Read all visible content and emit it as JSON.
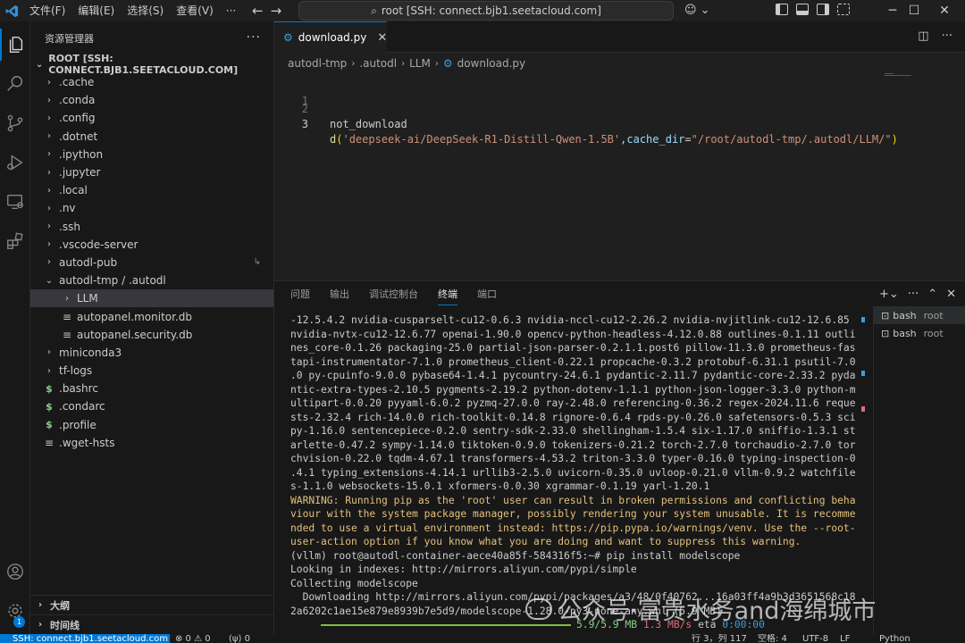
{
  "titlebar": {
    "menus": [
      "文件(F)",
      "编辑(E)",
      "选择(S)",
      "查看(V)"
    ],
    "more": "···",
    "search": "root [SSH: connect.bjb1.seetacloud.com]"
  },
  "sidebar": {
    "title": "资源管理器",
    "root": "ROOT [SSH: CONNECT.BJB1.SEETACLOUD.COM]",
    "items": [
      {
        "label": ".cache",
        "type": "folder"
      },
      {
        "label": ".conda",
        "type": "folder"
      },
      {
        "label": ".config",
        "type": "folder"
      },
      {
        "label": ".dotnet",
        "type": "folder"
      },
      {
        "label": ".ipython",
        "type": "folder"
      },
      {
        "label": ".jupyter",
        "type": "folder"
      },
      {
        "label": ".local",
        "type": "folder"
      },
      {
        "label": ".nv",
        "type": "folder"
      },
      {
        "label": ".ssh",
        "type": "folder"
      },
      {
        "label": ".vscode-server",
        "type": "folder"
      },
      {
        "label": "autodl-pub",
        "type": "folder"
      },
      {
        "label": "autodl-tmp / .autodl",
        "type": "folder-open"
      },
      {
        "label": "LLM",
        "type": "folder"
      },
      {
        "label": "autopanel.monitor.db",
        "type": "file"
      },
      {
        "label": "autopanel.security.db",
        "type": "file"
      },
      {
        "label": "miniconda3",
        "type": "folder"
      },
      {
        "label": "tf-logs",
        "type": "folder"
      },
      {
        "label": ".bashrc",
        "type": "shell"
      },
      {
        "label": ".condarc",
        "type": "shell"
      },
      {
        "label": ".profile",
        "type": "shell"
      },
      {
        "label": ".wget-hsts",
        "type": "file"
      }
    ],
    "outline": "大纲",
    "timeline": "时间线"
  },
  "editor": {
    "tab": "download.py",
    "breadcrumb": [
      "autodl-tmp",
      ".autodl",
      "LLM",
      "download.py"
    ],
    "lines": [
      {
        "num": "1",
        "text": ""
      },
      {
        "num": "2",
        "text": "not_download"
      },
      {
        "num": "3",
        "fn": "d",
        "paren_open": "(",
        "arg1": "'deepseek-ai/DeepSeek-R1-Distill-Qwen-1.5B'",
        "comma": ",",
        "param": "cache_dir",
        "eq": "=",
        "arg2": "\"/root/autodl-tmp/.autodl/LLM/\"",
        "paren_close": ")"
      }
    ]
  },
  "panel": {
    "tabs": [
      "问题",
      "输出",
      "调试控制台",
      "终端",
      "端口"
    ],
    "active_tab": "终端",
    "terminal_lines": [
      "-12.5.4.2 nvidia-cusparselt-cu12-0.6.3 nvidia-nccl-cu12-2.26.2 nvidia-nvjitlink-cu12-12.6.85",
      "nvidia-nvtx-cu12-12.6.77 openai-1.90.0 opencv-python-headless-4.12.0.88 outlines-0.1.11 outli",
      "nes_core-0.1.26 packaging-25.0 partial-json-parser-0.2.1.1.post6 pillow-11.3.0 prometheus-fas",
      "tapi-instrumentator-7.1.0 prometheus_client-0.22.1 propcache-0.3.2 protobuf-6.31.1 psutil-7.0",
      ".0 py-cpuinfo-9.0.0 pybase64-1.4.1 pycountry-24.6.1 pydantic-2.11.7 pydantic-core-2.33.2 pyda",
      "ntic-extra-types-2.10.5 pygments-2.19.2 python-dotenv-1.1.1 python-json-logger-3.3.0 python-m",
      "ultipart-0.0.20 pyyaml-6.0.2 pyzmq-27.0.0 ray-2.48.0 referencing-0.36.2 regex-2024.11.6 reque",
      "sts-2.32.4 rich-14.0.0 rich-toolkit-0.14.8 rignore-0.6.4 rpds-py-0.26.0 safetensors-0.5.3 sci",
      "py-1.16.0 sentencepiece-0.2.0 sentry-sdk-2.33.0 shellingham-1.5.4 six-1.17.0 sniffio-1.3.1 st",
      "arlette-0.47.2 sympy-1.14.0 tiktoken-0.9.0 tokenizers-0.21.2 torch-2.7.0 torchaudio-2.7.0 tor",
      "chvision-0.22.0 tqdm-4.67.1 transformers-4.53.2 triton-3.3.0 typer-0.16.0 typing-inspection-0",
      ".4.1 typing_extensions-4.14.1 urllib3-2.5.0 uvicorn-0.35.0 uvloop-0.21.0 vllm-0.9.2 watchfile",
      "s-1.1.0 websockets-15.0.1 xformers-0.0.30 xgrammar-0.1.19 yarl-1.20.1"
    ],
    "warning_lines": [
      "WARNING: Running pip as the 'root' user can result in broken permissions and conflicting beha",
      "viour with the system package manager, possibly rendering your system unusable. It is recomme",
      "nded to use a virtual environment instead: https://pip.pypa.io/warnings/venv. Use the --root-",
      "user-action option if you know what you are doing and want to suppress this warning."
    ],
    "after_lines": [
      "(vllm) root@autodl-container-aece40a85f-584316f5:~# pip install modelscope",
      "Looking in indexes: http://mirrors.aliyun.com/pypi/simple",
      "Collecting modelscope",
      "  Downloading http://mirrors.aliyun.com/pypi/packages/a3/48/0f40762...16a03ff4a9b3d3651568c18",
      "2a6202c1ae15e879e8939b7e5d9/modelscope-1.28.0-py3-none-any.whl (5.9 MB)"
    ],
    "progress": {
      "fraction": 1.0,
      "size": "5.9/5.9 MB",
      "speed": "1.3 MB/s",
      "eta_label": "eta",
      "eta": "0:00:00"
    },
    "terminals": [
      {
        "name": "bash",
        "sub": "root"
      },
      {
        "name": "bash",
        "sub": "root"
      }
    ]
  },
  "statusbar": {
    "remote": "SSH: connect.bjb1.seetacloud.com",
    "problems": "⊗ 0 ⚠ 0",
    "ports": "(ψ) 0",
    "position": "行 3，列 117",
    "spaces": "空格: 4",
    "encoding": "UTF-8",
    "eol": "LF",
    "language": "Python"
  },
  "activity": {
    "badge": "1"
  },
  "watermark": "公众号·富贵水务and海绵城市",
  "colors": {
    "accent": "#0078d4",
    "warning": "#e5c07b",
    "string": "#ce9178"
  }
}
